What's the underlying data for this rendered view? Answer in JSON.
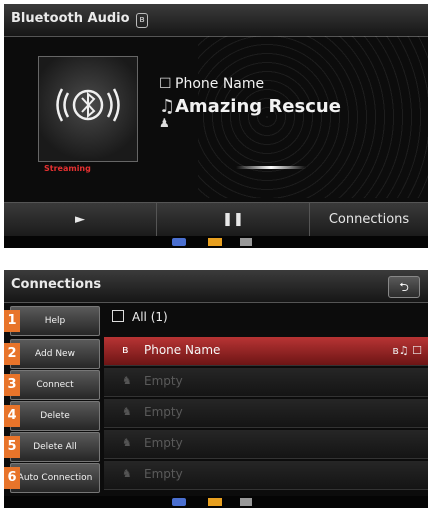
{
  "top": {
    "title": "Bluetooth Audio",
    "bt_icon_glyph": "ʙ",
    "streaming_label": "Streaming",
    "phone_name": "Phone Name",
    "song": "Amazing Rescue",
    "phone_icon": "☐",
    "music_icon": "♫",
    "person_icon": "♟",
    "controls": {
      "play": "►",
      "pause": "❚❚",
      "connections": "Connections"
    }
  },
  "connections": {
    "title": "Connections",
    "return_glyph": "⮌",
    "all_label": "All (1)",
    "sidebar": [
      {
        "num": "1",
        "label": "Help"
      },
      {
        "num": "2",
        "label": "Add New"
      },
      {
        "num": "3",
        "label": "Connect"
      },
      {
        "num": "4",
        "label": "Delete"
      },
      {
        "num": "5",
        "label": "Delete All"
      },
      {
        "num": "6",
        "label": "Auto Connection"
      }
    ],
    "rows": [
      {
        "label": "Phone Name",
        "icon": "ʙ",
        "selected": true,
        "trail": "ʙ♫ ☐"
      },
      {
        "label": "Empty",
        "icon": "♞"
      },
      {
        "label": "Empty",
        "icon": "♞"
      },
      {
        "label": "Empty",
        "icon": "♞"
      },
      {
        "label": "Empty",
        "icon": "♞"
      }
    ]
  },
  "colors": {
    "accent": "#e8742a",
    "selected_row": "#b83434",
    "streaming": "#e53030"
  }
}
